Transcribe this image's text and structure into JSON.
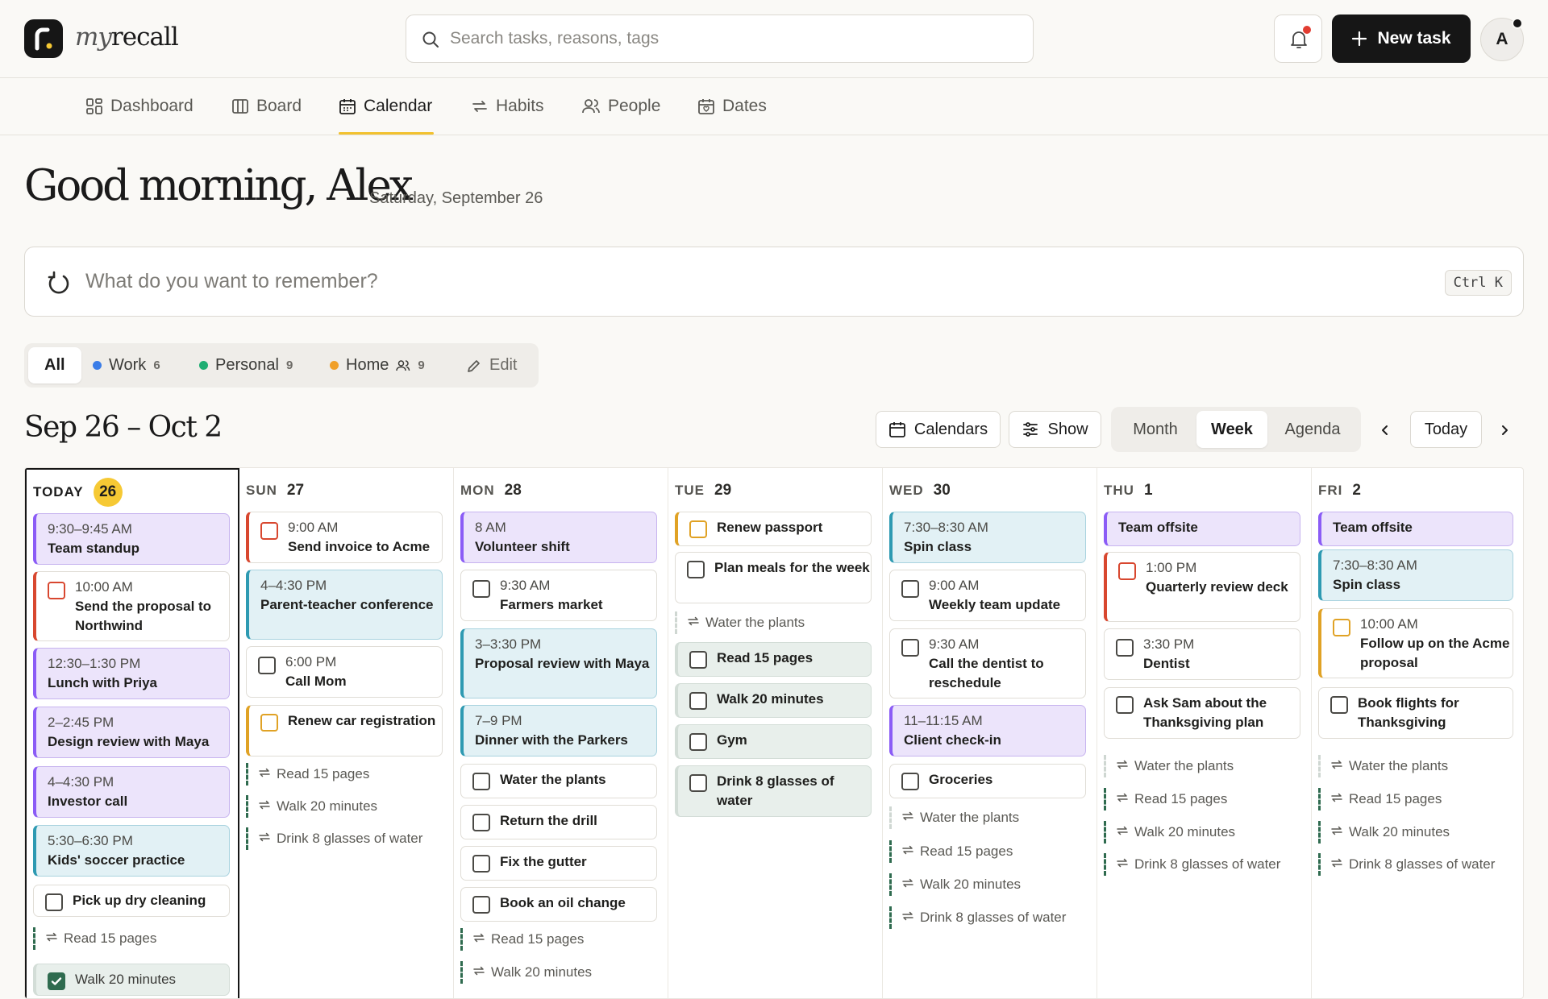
{
  "app": {
    "brand_italic": "my",
    "brand_bold": "recall"
  },
  "search": {
    "placeholder": "Search tasks, reasons, tags"
  },
  "header": {
    "new_task_label": "New task",
    "avatar_initial": "A"
  },
  "nav": {
    "items": [
      {
        "label": "Dashboard",
        "icon": "dashboard-icon"
      },
      {
        "label": "Board",
        "icon": "board-icon"
      },
      {
        "label": "Calendar",
        "icon": "calendar-icon",
        "active": true
      },
      {
        "label": "Habits",
        "icon": "repeat-icon"
      },
      {
        "label": "People",
        "icon": "people-icon"
      },
      {
        "label": "Dates",
        "icon": "dates-icon"
      }
    ]
  },
  "greeting": {
    "title": "Good morning, Alex",
    "date": "Saturday, September 26"
  },
  "quick_add": {
    "placeholder": "What do you want to remember?",
    "shortcut": "Ctrl K"
  },
  "filters": {
    "all_label": "All",
    "items": [
      {
        "label": "Work",
        "count": "6",
        "color": "#3b7de8"
      },
      {
        "label": "Personal",
        "count": "9",
        "color": "#1fae73"
      },
      {
        "label": "Home",
        "count": "9",
        "color": "#f0a02a",
        "shared": true
      }
    ],
    "edit_label": "Edit"
  },
  "calendar": {
    "range_title": "Sep 26 – Oct 2",
    "calendars_label": "Calendars",
    "show_label": "Show",
    "views": [
      "Month",
      "Week",
      "Agenda"
    ],
    "active_view": "Week",
    "today_label": "Today",
    "days": [
      {
        "dow": "TODAY",
        "num": "26",
        "today": true,
        "items": [
          {
            "kind": "event",
            "cat": "work",
            "time": "9:30–9:45 AM",
            "title": "Team standup"
          },
          {
            "kind": "task",
            "accent": "red",
            "time": "10:00 AM",
            "title": "Send the proposal to Northwind"
          },
          {
            "kind": "event",
            "cat": "work",
            "time": "12:30–1:30 PM",
            "title": "Lunch with Priya"
          },
          {
            "kind": "event",
            "cat": "work",
            "time": "2–2:45 PM",
            "title": "Design review with Maya"
          },
          {
            "kind": "event",
            "cat": "work",
            "time": "4–4:30 PM",
            "title": "Investor call"
          },
          {
            "kind": "event",
            "cat": "personal",
            "time": "5:30–6:30 PM",
            "title": "Kids' soccer practice"
          },
          {
            "kind": "task",
            "accent": "plain",
            "title": "Pick up dry cleaning"
          },
          {
            "kind": "habit",
            "title": "Read 15 pages"
          },
          {
            "kind": "task",
            "accent": "green",
            "done": true,
            "title": "Walk 20 minutes"
          }
        ]
      },
      {
        "dow": "SUN",
        "num": "27",
        "items": [
          {
            "kind": "task",
            "accent": "red",
            "time": "9:00 AM",
            "title": "Send invoice to Acme"
          },
          {
            "kind": "event",
            "cat": "personal",
            "time": "4–4:30 PM",
            "title": "Parent-teacher conference"
          },
          {
            "kind": "task",
            "accent": "plain",
            "time": "6:00 PM",
            "title": "Call Mom"
          },
          {
            "kind": "task",
            "accent": "amber",
            "title": "Renew car registration"
          },
          {
            "kind": "habit",
            "title": "Read 15 pages"
          },
          {
            "kind": "habit",
            "title": "Walk 20 minutes"
          },
          {
            "kind": "habit",
            "title": "Drink 8 glasses of water"
          }
        ]
      },
      {
        "dow": "MON",
        "num": "28",
        "items": [
          {
            "kind": "event",
            "cat": "work",
            "time": "8 AM",
            "title": "Volunteer shift"
          },
          {
            "kind": "task",
            "accent": "plain",
            "time": "9:30 AM",
            "title": "Farmers market"
          },
          {
            "kind": "event",
            "cat": "personal",
            "time": "3–3:30 PM",
            "title": "Proposal review with Maya"
          },
          {
            "kind": "event",
            "cat": "personal",
            "time": "7–9 PM",
            "title": "Dinner with the Parkers"
          },
          {
            "kind": "task",
            "accent": "plain",
            "title": "Water the plants"
          },
          {
            "kind": "task",
            "accent": "plain",
            "title": "Return the drill"
          },
          {
            "kind": "task",
            "accent": "plain",
            "title": "Fix the gutter"
          },
          {
            "kind": "task",
            "accent": "plain",
            "title": "Book an oil change"
          },
          {
            "kind": "habit",
            "title": "Read 15 pages"
          },
          {
            "kind": "habit",
            "title": "Walk 20 minutes"
          }
        ]
      },
      {
        "dow": "TUE",
        "num": "29",
        "items": [
          {
            "kind": "task",
            "accent": "amber",
            "title": "Renew passport"
          },
          {
            "kind": "task",
            "accent": "plain",
            "title": "Plan meals for the week"
          },
          {
            "kind": "habit",
            "light": true,
            "title": "Water the plants"
          },
          {
            "kind": "task",
            "accent": "green",
            "title": "Read 15 pages"
          },
          {
            "kind": "task",
            "accent": "green",
            "title": "Walk 20 minutes"
          },
          {
            "kind": "task",
            "accent": "green",
            "title": "Gym"
          },
          {
            "kind": "task",
            "accent": "green",
            "title": "Drink 8 glasses of water"
          }
        ]
      },
      {
        "dow": "WED",
        "num": "30",
        "items": [
          {
            "kind": "event",
            "cat": "personal",
            "time": "7:30–8:30 AM",
            "title": "Spin class"
          },
          {
            "kind": "task",
            "accent": "plain",
            "time": "9:00 AM",
            "title": "Weekly team update"
          },
          {
            "kind": "task",
            "accent": "plain",
            "time": "9:30 AM",
            "title": "Call the dentist to reschedule"
          },
          {
            "kind": "event",
            "cat": "work",
            "time": "11–11:15 AM",
            "title": "Client check-in"
          },
          {
            "kind": "task",
            "accent": "plain",
            "title": "Groceries"
          },
          {
            "kind": "habit",
            "light": true,
            "title": "Water the plants"
          },
          {
            "kind": "habit",
            "title": "Read 15 pages"
          },
          {
            "kind": "habit",
            "title": "Walk 20 minutes"
          },
          {
            "kind": "habit",
            "title": "Drink 8 glasses of water"
          }
        ]
      },
      {
        "dow": "THU",
        "num": "1",
        "items": [
          {
            "kind": "event",
            "cat": "work",
            "title": "Team offsite"
          },
          {
            "kind": "task",
            "accent": "red",
            "time": "1:00 PM",
            "title": "Quarterly review deck"
          },
          {
            "kind": "task",
            "accent": "plain",
            "time": "3:30 PM",
            "title": "Dentist"
          },
          {
            "kind": "task",
            "accent": "plain",
            "title": "Ask Sam about the Thanksgiving plan"
          },
          {
            "kind": "habit",
            "light": true,
            "title": "Water the plants"
          },
          {
            "kind": "habit",
            "title": "Read 15 pages"
          },
          {
            "kind": "habit",
            "title": "Walk 20 minutes"
          },
          {
            "kind": "habit",
            "title": "Drink 8 glasses of water"
          }
        ]
      },
      {
        "dow": "FRI",
        "num": "2",
        "items": [
          {
            "kind": "event",
            "cat": "work",
            "title": "Team offsite"
          },
          {
            "kind": "event",
            "cat": "personal",
            "time": "7:30–8:30 AM",
            "title": "Spin class"
          },
          {
            "kind": "task",
            "accent": "amber",
            "time": "10:00 AM",
            "title": "Follow up on the Acme proposal"
          },
          {
            "kind": "task",
            "accent": "plain",
            "title": "Book flights for Thanksgiving"
          },
          {
            "kind": "habit",
            "light": true,
            "title": "Water the plants"
          },
          {
            "kind": "habit",
            "title": "Read 15 pages"
          },
          {
            "kind": "habit",
            "title": "Walk 20 minutes"
          },
          {
            "kind": "habit",
            "title": "Drink 8 glasses of water"
          }
        ]
      }
    ]
  }
}
